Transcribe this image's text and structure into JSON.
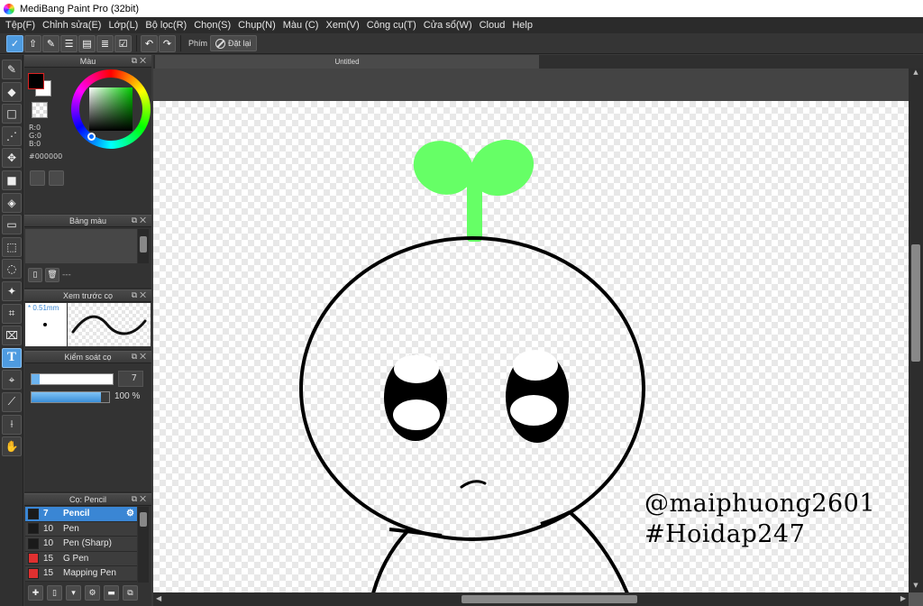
{
  "window": {
    "title": "MediBang Paint Pro (32bit)"
  },
  "menu": [
    "Tệp(F)",
    "Chỉnh sửa(E)",
    "Lớp(L)",
    "Bộ lọc(R)",
    "Chọn(S)",
    "Chụp(N)",
    "Màu (C)",
    "Xem(V)",
    "Công cụ(T)",
    "Cửa sổ(W)",
    "Cloud",
    "Help"
  ],
  "toolbar": {
    "shortcut_label": "Phím",
    "reset_label": "Đặt lại"
  },
  "panels": {
    "color": {
      "title": "Màu",
      "rgb": {
        "r": "R:0",
        "g": "G:0",
        "b": "B:0"
      },
      "hex": "#000000",
      "fg": "#000000",
      "bg": "#ffffff"
    },
    "palette": {
      "title": "Bảng màu",
      "more": "---"
    },
    "brush_preview": {
      "title": "Xem trước cọ",
      "size": "* 0.51mm"
    },
    "brush_control": {
      "title": "Kiểm soát cọ",
      "size_value": "7",
      "opacity_value": "100 %",
      "opacity_fraction": 0.9
    },
    "brush_list": {
      "title": "Cọ: Pencil",
      "items": [
        {
          "size": "7",
          "name": "Pencil",
          "color": "#1a1a1a",
          "selected": true
        },
        {
          "size": "10",
          "name": "Pen",
          "color": "#1a1a1a",
          "selected": false
        },
        {
          "size": "10",
          "name": "Pen (Sharp)",
          "color": "#1a1a1a",
          "selected": false
        },
        {
          "size": "15",
          "name": "G Pen",
          "color": "#e03030",
          "selected": false
        },
        {
          "size": "15",
          "name": "Mapping Pen",
          "color": "#e03030",
          "selected": false
        }
      ]
    }
  },
  "document": {
    "tab": "Untitled",
    "watermark_line1": "@maiphuong2601",
    "watermark_line2": "#Hoidap247",
    "sprout_color": "#66ff66"
  }
}
